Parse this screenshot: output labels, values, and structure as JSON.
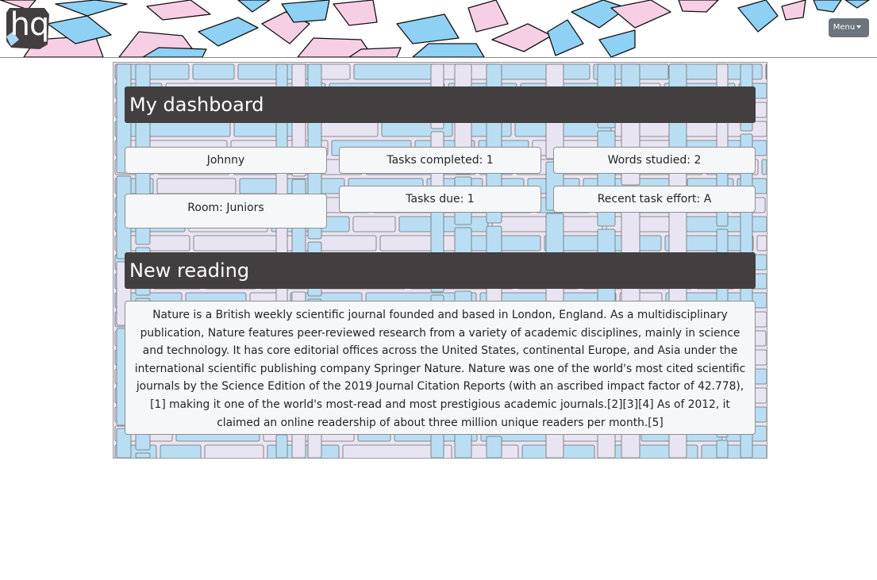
{
  "header": {
    "logo_text": "hq",
    "menu_label": "Menu"
  },
  "dashboard": {
    "title": "My dashboard",
    "name": "Johnny",
    "room": "Room: Juniors",
    "tasks_completed": "Tasks completed: 1",
    "tasks_due": "Tasks due: 1",
    "words_studied": "Words studied: 2",
    "recent_effort": "Recent task effort: A"
  },
  "reading": {
    "title": "New reading",
    "text": "Nature is a British weekly scientific journal founded and based in London, England. As a multidisciplinary publication, Nature features peer-reviewed research from a variety of academic disciplines, mainly in science and technology. It has core editorial offices across the United States, continental Europe, and Asia under the international scientific publishing company Springer Nature. Nature was one of the world's most cited scientific journals by the Science Edition of the 2019 Journal Citation Reports (with an ascribed impact factor of 42.778),[1] making it one of the world's most-read and most prestigious academic journals.[2][3][4] As of 2012, it claimed an online readership of about three million unique readers per month.[5]"
  },
  "colors": {
    "title_bar": "#433e3f",
    "card_bg": "#f6f7f8",
    "paper_blue": "#8fd0f5",
    "paper_pink": "#f7cfe4",
    "book_blue": "#b9def3",
    "book_lavender": "#e9e4f2",
    "menu_button": "#6c757d"
  }
}
